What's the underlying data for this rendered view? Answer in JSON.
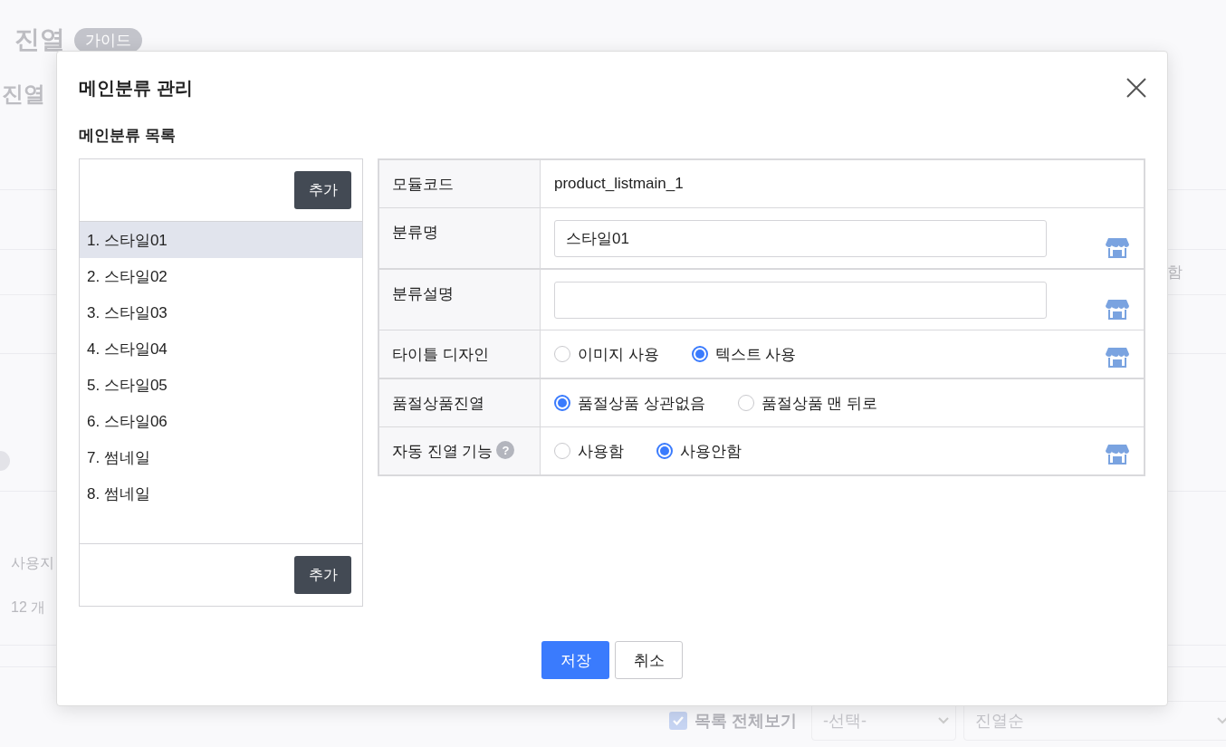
{
  "background": {
    "title": "진열",
    "badge": "가이드",
    "subtitle": "진열",
    "row_text": "함",
    "usage_label": "사용지",
    "count": "12 개",
    "show_all": {
      "label": "목록 전체보기",
      "checked": true
    },
    "selects": [
      {
        "value": "-선택-"
      },
      {
        "value": "진열순"
      }
    ]
  },
  "dialog": {
    "title": "메인분류 관리",
    "section_title": "메인분류 목록",
    "add_buttons": [
      "추가",
      "추가"
    ],
    "list": [
      {
        "label": "1. 스타일01",
        "selected": true
      },
      {
        "label": "2. 스타일02",
        "selected": false
      },
      {
        "label": "3. 스타일03",
        "selected": false
      },
      {
        "label": "4. 스타일04",
        "selected": false
      },
      {
        "label": "5. 스타일05",
        "selected": false
      },
      {
        "label": "6. 스타일06",
        "selected": false
      },
      {
        "label": "7. 썸네일",
        "selected": false
      },
      {
        "label": "8. 썸네일",
        "selected": false
      }
    ],
    "fields": [
      {
        "kind": "text",
        "label": "모듈코드",
        "value": "product_listmain_1",
        "shop_icon": false
      },
      {
        "kind": "input",
        "label": "분류명",
        "value": "스타일01",
        "shop_icon": true
      },
      {
        "kind": "input",
        "label": "분류설명",
        "shop_icon": true
      },
      {
        "kind": "radio",
        "label": "타이틀 디자인",
        "shop_icon": true,
        "options": [
          {
            "label": "이미지 사용",
            "selected": false
          },
          {
            "label": "텍스트 사용",
            "selected": true
          }
        ]
      },
      {
        "kind": "radio",
        "label": "품절상품진열",
        "shop_icon": false,
        "options": [
          {
            "label": "품절상품 상관없음",
            "selected": true
          },
          {
            "label": "품절상품 맨 뒤로",
            "selected": false
          }
        ]
      },
      {
        "kind": "radio",
        "label": "자동 진열 기능",
        "help": "?",
        "shop_icon": true,
        "options": [
          {
            "label": "사용함",
            "selected": false
          },
          {
            "label": "사용안함",
            "selected": true
          }
        ]
      }
    ],
    "buttons": [
      {
        "label": "저장",
        "kind": "primary"
      },
      {
        "label": "취소",
        "kind": "secondary"
      }
    ]
  }
}
